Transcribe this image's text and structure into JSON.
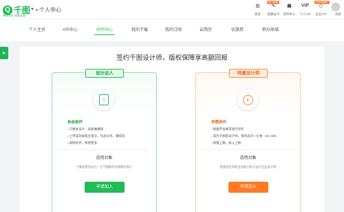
{
  "brand": {
    "logo_mark": "Q",
    "logo_text": "千图",
    "slogan": "原创设计 创意无限",
    "caret": "▼",
    "page_name": "• 个人中心"
  },
  "header_icons": [
    {
      "icon": "grid-icon",
      "glyph": "⊞",
      "label": "更多"
    },
    {
      "icon": "designer-icon",
      "glyph": "✎",
      "label": "招募设计",
      "badge": "热门招募"
    },
    {
      "icon": "creator-icon",
      "glyph": "☗",
      "label": "创作中心"
    },
    {
      "icon": "vip-icon",
      "glyph": "VIP",
      "label": "个人VIP"
    },
    {
      "icon": "diamond-icon",
      "glyph": "◇",
      "label": "企业VIP",
      "badge": "企业版限时"
    }
  ],
  "user": {
    "avatar_label": "消息"
  },
  "nav_tabs": [
    {
      "label": "个人主页",
      "active": false
    },
    {
      "label": "VIP中心",
      "active": false
    },
    {
      "label": "创作中心",
      "active": true
    },
    {
      "label": "我的下载",
      "active": false
    },
    {
      "label": "我的订阅",
      "active": false
    },
    {
      "label": "云简历",
      "active": false
    },
    {
      "label": "优惠券",
      "active": false
    },
    {
      "label": "积分商城",
      "active": false
    }
  ],
  "side_toggle": "▸",
  "panel": {
    "title": "签约千图设计师，版权保障享高额回报",
    "cards": [
      {
        "tag": "设计达人",
        "icon": "portrait-badge-icon",
        "feature_title": "自由创作",
        "features": [
          "只要会设计，就能做赚钱",
          "上传成功就能立得分，作品分享，赚得多",
          "按照好坏，挣到更多"
        ],
        "applies_title": "适用对象",
        "applies_desc": "只要是原创设计，在千图都有你想要的收入",
        "button": "申请加入"
      },
      {
        "tag": "特邀设计师",
        "icon": "medal-badge-icon",
        "feature_title": "命题创作",
        "features": [
          "根据平台要求进行创作",
          "成为千图第设计师，每作品可一价格（2k~30k）",
          "质量上乘，收入上限"
        ],
        "applies_title": "适用对象",
        "applies_desc": "擅速度达等职业有能力的方设计企业设计师",
        "button": "申请加入"
      }
    ]
  },
  "colors": {
    "brand_green": "#22bb55",
    "accent_orange": "#ff7a22"
  }
}
